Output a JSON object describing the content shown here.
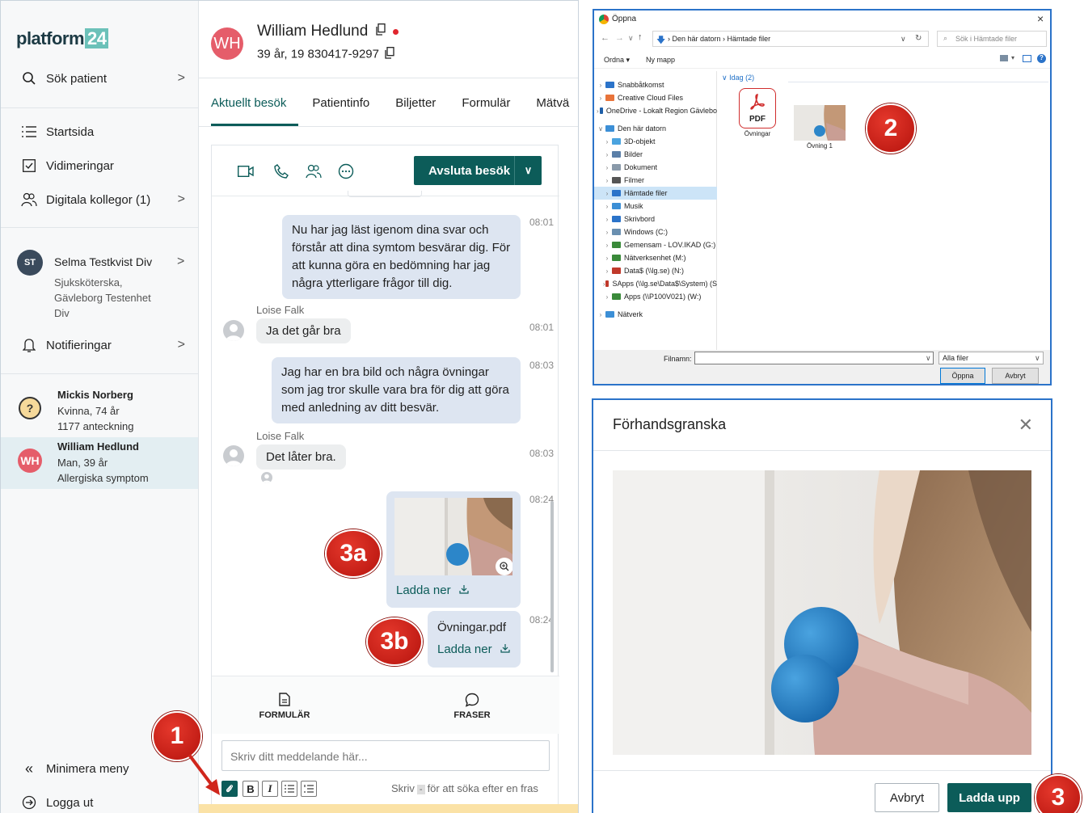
{
  "sidebar": {
    "logo_text": "platform",
    "logo_num": "24",
    "search_label": "Sök patient",
    "items": [
      {
        "label": "Startsida"
      },
      {
        "label": "Vidimeringar"
      },
      {
        "label": "Digitala kollegor (1)"
      }
    ],
    "user": {
      "initials": "ST",
      "name": "Selma Testkvist Div",
      "role_line1": "Sjuksköterska,",
      "role_line2": "Gävleborg Testenhet",
      "role_line3": "Div"
    },
    "notifications_label": "Notifieringar",
    "patients": [
      {
        "name": "Mickis Norberg",
        "line1": "Kvinna, 74 år",
        "line2": "1177 anteckning",
        "icon": "?"
      },
      {
        "name": "William Hedlund",
        "line1": "Man, 39 år",
        "line2": "Allergiska symptom",
        "initials": "WH"
      }
    ],
    "minimize_label": "Minimera meny",
    "logout_label": "Logga ut"
  },
  "header": {
    "initials": "WH",
    "name": "William Hedlund",
    "sub": "39 år, 19 830417-9297",
    "status_color": "#e0262e"
  },
  "tabs": [
    "Aktuellt besök",
    "Patientinfo",
    "Biljetter",
    "Formulär",
    "Mätvä"
  ],
  "chat": {
    "end_visit_label": "Avsluta besök",
    "messages": {
      "m1": {
        "text": "Nu har jag läst igenom dina svar och förstår att dina symtom besvärar dig. För att kunna göra en bedömning har jag några ytterligare frågor till dig.",
        "time": "08:01"
      },
      "m2": {
        "sender": "Loise Falk",
        "text": "Ja det går bra",
        "time": "08:01"
      },
      "m3": {
        "text": "Jag har en bra bild och några övningar som jag tror skulle vara bra för dig att göra med anledning av ditt besvär.",
        "time": "08:03"
      },
      "m4": {
        "sender": "Loise Falk",
        "text": "Det låter bra.",
        "time": "08:03"
      },
      "m5": {
        "download_label": "Ladda ner",
        "time": "08:24"
      },
      "m6": {
        "filename": "Övningar.pdf",
        "download_label": "Ladda ner",
        "time": "08:24"
      }
    },
    "tools": {
      "form_label": "FORMULÄR",
      "phrases_label": "FRASER"
    },
    "input_placeholder": "Skriv ditt meddelande här...",
    "hint_prefix": "Skriv",
    "hint_key": "-",
    "hint_suffix": "för att söka efter en fras",
    "format_bold": "B",
    "format_italic": "I"
  },
  "callouts": {
    "c1": "1",
    "c2": "2",
    "c3": "3",
    "c3a": "3a",
    "c3b": "3b"
  },
  "file_dialog": {
    "title": "Öppna",
    "path_1": "Den här datorn",
    "path_2": "Hämtade filer",
    "search_placeholder": "Sök i Hämtade filer",
    "organize_label": "Ordna ▾",
    "new_folder_label": "Ny mapp",
    "group_label": "Idag (2)",
    "tree": [
      {
        "label": "Snabbåtkomst",
        "color": "#2b73c9"
      },
      {
        "label": "Creative Cloud Files",
        "color": "#e8733a"
      },
      {
        "label": "OneDrive - Lokalt Region Gävlebo",
        "color": "#1f5fa8"
      },
      {
        "label": "Den här datorn",
        "color": "#3c8fd6"
      },
      {
        "label": "3D-objekt",
        "color": "#4aa3df"
      },
      {
        "label": "Bilder",
        "color": "#5b7fa8"
      },
      {
        "label": "Dokument",
        "color": "#8a9aaa"
      },
      {
        "label": "Filmer",
        "color": "#555"
      },
      {
        "label": "Hämtade filer",
        "color": "#2b73c9"
      },
      {
        "label": "Musik",
        "color": "#3c8fd6"
      },
      {
        "label": "Skrivbord",
        "color": "#2b73c9"
      },
      {
        "label": "Windows (C:)",
        "color": "#6a8fb0"
      },
      {
        "label": "Gemensam - LOV.IKAD (G:)",
        "color": "#3a8a3a"
      },
      {
        "label": "Nätverksenhet (M:)",
        "color": "#3a8a3a"
      },
      {
        "label": "Data$ (\\\\lg.se) (N:)",
        "color": "#c0392b"
      },
      {
        "label": "SApps (\\\\lg.se\\Data$\\System) (S",
        "color": "#c0392b"
      },
      {
        "label": "Apps (\\\\P100V021) (W:)",
        "color": "#3a8a3a"
      },
      {
        "label": "Nätverk",
        "color": "#3c8fd6"
      }
    ],
    "files": [
      {
        "name": "Övningar",
        "type_label": "PDF"
      },
      {
        "name": "Övning 1"
      }
    ],
    "filename_label": "Filnamn:",
    "filter_label": "Alla filer",
    "open_label": "Öppna",
    "cancel_label": "Avbryt"
  },
  "preview": {
    "title": "Förhandsgranska",
    "cancel_label": "Avbryt",
    "upload_label": "Ladda upp"
  },
  "colors": {
    "brand": "#0c5c59",
    "accent": "#6cc1b9",
    "callout": "#d0261c"
  }
}
